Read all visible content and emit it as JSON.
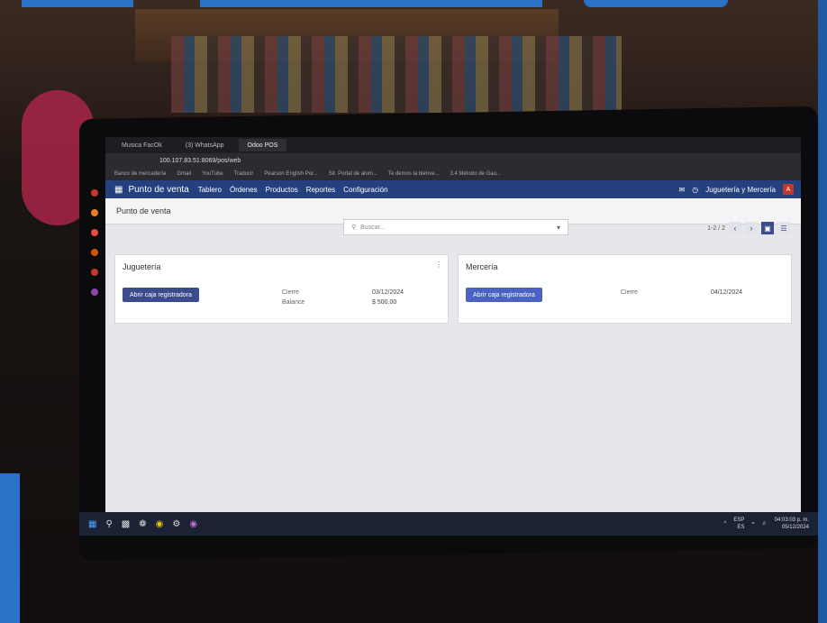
{
  "browser": {
    "tabs": [
      "Musica FacOk",
      "(3) WhatsApp",
      "Odoo POS"
    ],
    "address": "100.107.83.51:8069/pos/web",
    "bookmarks": [
      "Banco de mercadería",
      "Gmail",
      "YouTube",
      "Traducir",
      "Pearson English Por...",
      "Sit. Portal de alum...",
      "Te demos la bienve...",
      "3.4 Método de Gau..."
    ]
  },
  "navbar": {
    "app_title": "Punto de venta",
    "menu": [
      "Tablero",
      "Órdenes",
      "Productos",
      "Reportes",
      "Configuración"
    ],
    "company": "Juguetería y Mercería",
    "avatar": "A"
  },
  "control": {
    "breadcrumb": "Punto de venta",
    "search_placeholder": "Buscar...",
    "pager": "1-2 / 2"
  },
  "cards": [
    {
      "title": "Juguetería",
      "button": "Abrir caja registradora",
      "closing_label": "Cierre",
      "closing_value": "03/12/2024",
      "balance_label": "Balance",
      "balance_value": "$ 500.00"
    },
    {
      "title": "Mercería",
      "button": "Abrir caja registradora",
      "closing_label": "Cierre",
      "closing_value": "04/12/2024"
    }
  ],
  "taskbar": {
    "lang_top": "ESP",
    "lang_bottom": "ES",
    "time": "04:03:03 p. m.",
    "date": "05/12/2024"
  }
}
